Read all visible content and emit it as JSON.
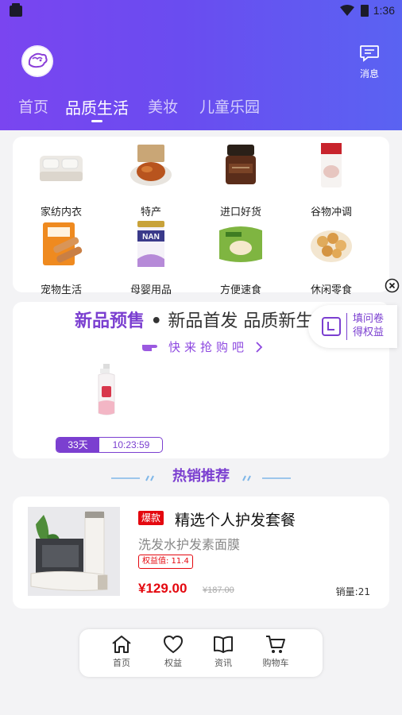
{
  "statusbar": {
    "time": "1:36"
  },
  "header": {
    "message_label": "消息",
    "tabs": [
      {
        "label": "首页"
      },
      {
        "label": "品质生活"
      },
      {
        "label": "美妆"
      },
      {
        "label": "儿童乐园"
      }
    ],
    "active_tab": "品质生活"
  },
  "categories": [
    {
      "label": "家纺内衣",
      "icon": "bedding-image"
    },
    {
      "label": "特产",
      "icon": "roast-chicken-image"
    },
    {
      "label": "进口好货",
      "icon": "cosmetic-jar-image"
    },
    {
      "label": "谷物冲调",
      "icon": "cereal-bag-image"
    },
    {
      "label": "宠物生活",
      "icon": "pet-treat-image"
    },
    {
      "label": "母婴用品",
      "icon": "milk-powder-image"
    },
    {
      "label": "方便速食",
      "icon": "instant-noodle-image"
    },
    {
      "label": "休闲零食",
      "icon": "snack-image"
    }
  ],
  "promo": {
    "title_bold": "新品预售",
    "title_rest": "新品首发 品质新生",
    "subtitle": "快来抢购吧",
    "countdown_days": "33天",
    "countdown_time": "10:23:59"
  },
  "survey": {
    "line1": "填问卷",
    "line2": "得权益"
  },
  "hot_section": {
    "title": "热销推荐"
  },
  "product": {
    "badge": "爆款",
    "title": "精选个人护发套餐",
    "subtitle": "洗发水护发素面膜",
    "rights_label": "权益值: 11.4",
    "price": "¥129.00",
    "original_price": "¥187.00",
    "sales": "销量:21"
  },
  "bottom_nav": [
    {
      "label": "首页",
      "icon": "home-icon"
    },
    {
      "label": "权益",
      "icon": "heart-icon"
    },
    {
      "label": "资讯",
      "icon": "book-icon"
    },
    {
      "label": "购物车",
      "icon": "cart-icon"
    }
  ],
  "colors": {
    "accent": "#7b3fd0",
    "price_red": "#e4080f",
    "header_start": "#7a45f0",
    "header_end": "#5a63f2"
  }
}
